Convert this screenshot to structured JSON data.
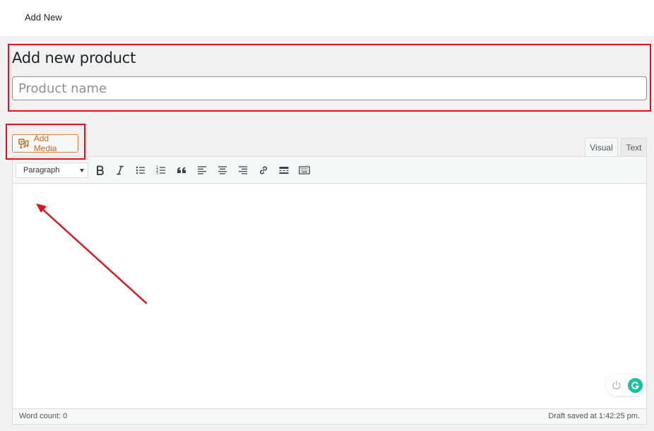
{
  "topbar": {
    "breadcrumb": "Add New"
  },
  "heading": "Add new product",
  "title_input": {
    "value": "",
    "placeholder": "Product name"
  },
  "media": {
    "add_media_label": "Add Media"
  },
  "editor": {
    "tabs": [
      {
        "label": "Visual",
        "active": true
      },
      {
        "label": "Text",
        "active": false
      }
    ],
    "format_select": "Paragraph",
    "toolbar_buttons": [
      "bold",
      "italic",
      "bulleted-list",
      "numbered-list",
      "blockquote",
      "align-left",
      "align-center",
      "align-right",
      "insert-link",
      "read-more",
      "toolbar-toggle"
    ],
    "content": ""
  },
  "status": {
    "word_count": "Word count: 0",
    "draft_saved": "Draft saved at 1:42:25 pm."
  },
  "annotations": {
    "highlight_color": "#e0121b"
  },
  "colors": {
    "accent_orange": "#c66a1f",
    "grammarly_green": "#15c39a",
    "background": "#f1f1f1"
  }
}
